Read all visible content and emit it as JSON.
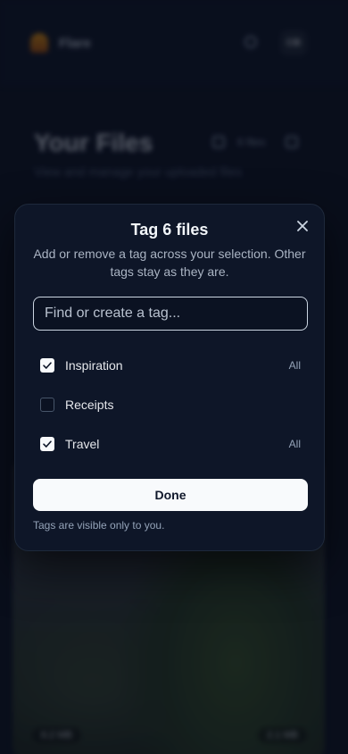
{
  "background": {
    "brand_name": "Flare",
    "avatar_initials": "CB",
    "page_title": "Your Files",
    "page_subtitle": "View and manage your uploaded files",
    "file_count": "6 files",
    "photo_left_chip": "6.2 MB",
    "photo_right_chip": "2.1 MB"
  },
  "modal": {
    "title": "Tag 6 files",
    "description": "Add or remove a tag across your selection. Other tags stay as they are.",
    "search_placeholder": "Find or create a tag...",
    "search_value": "",
    "tags": [
      {
        "label": "Inspiration",
        "checked": true,
        "scope": "All"
      },
      {
        "label": "Receipts",
        "checked": false,
        "scope": ""
      },
      {
        "label": "Travel",
        "checked": true,
        "scope": "All"
      }
    ],
    "done_label": "Done",
    "footnote": "Tags are visible only to you.",
    "close_icon": "close-icon"
  },
  "colors": {
    "background": "#0b1120",
    "modal": "#0e1628",
    "primary_button": "#f8fafc"
  }
}
